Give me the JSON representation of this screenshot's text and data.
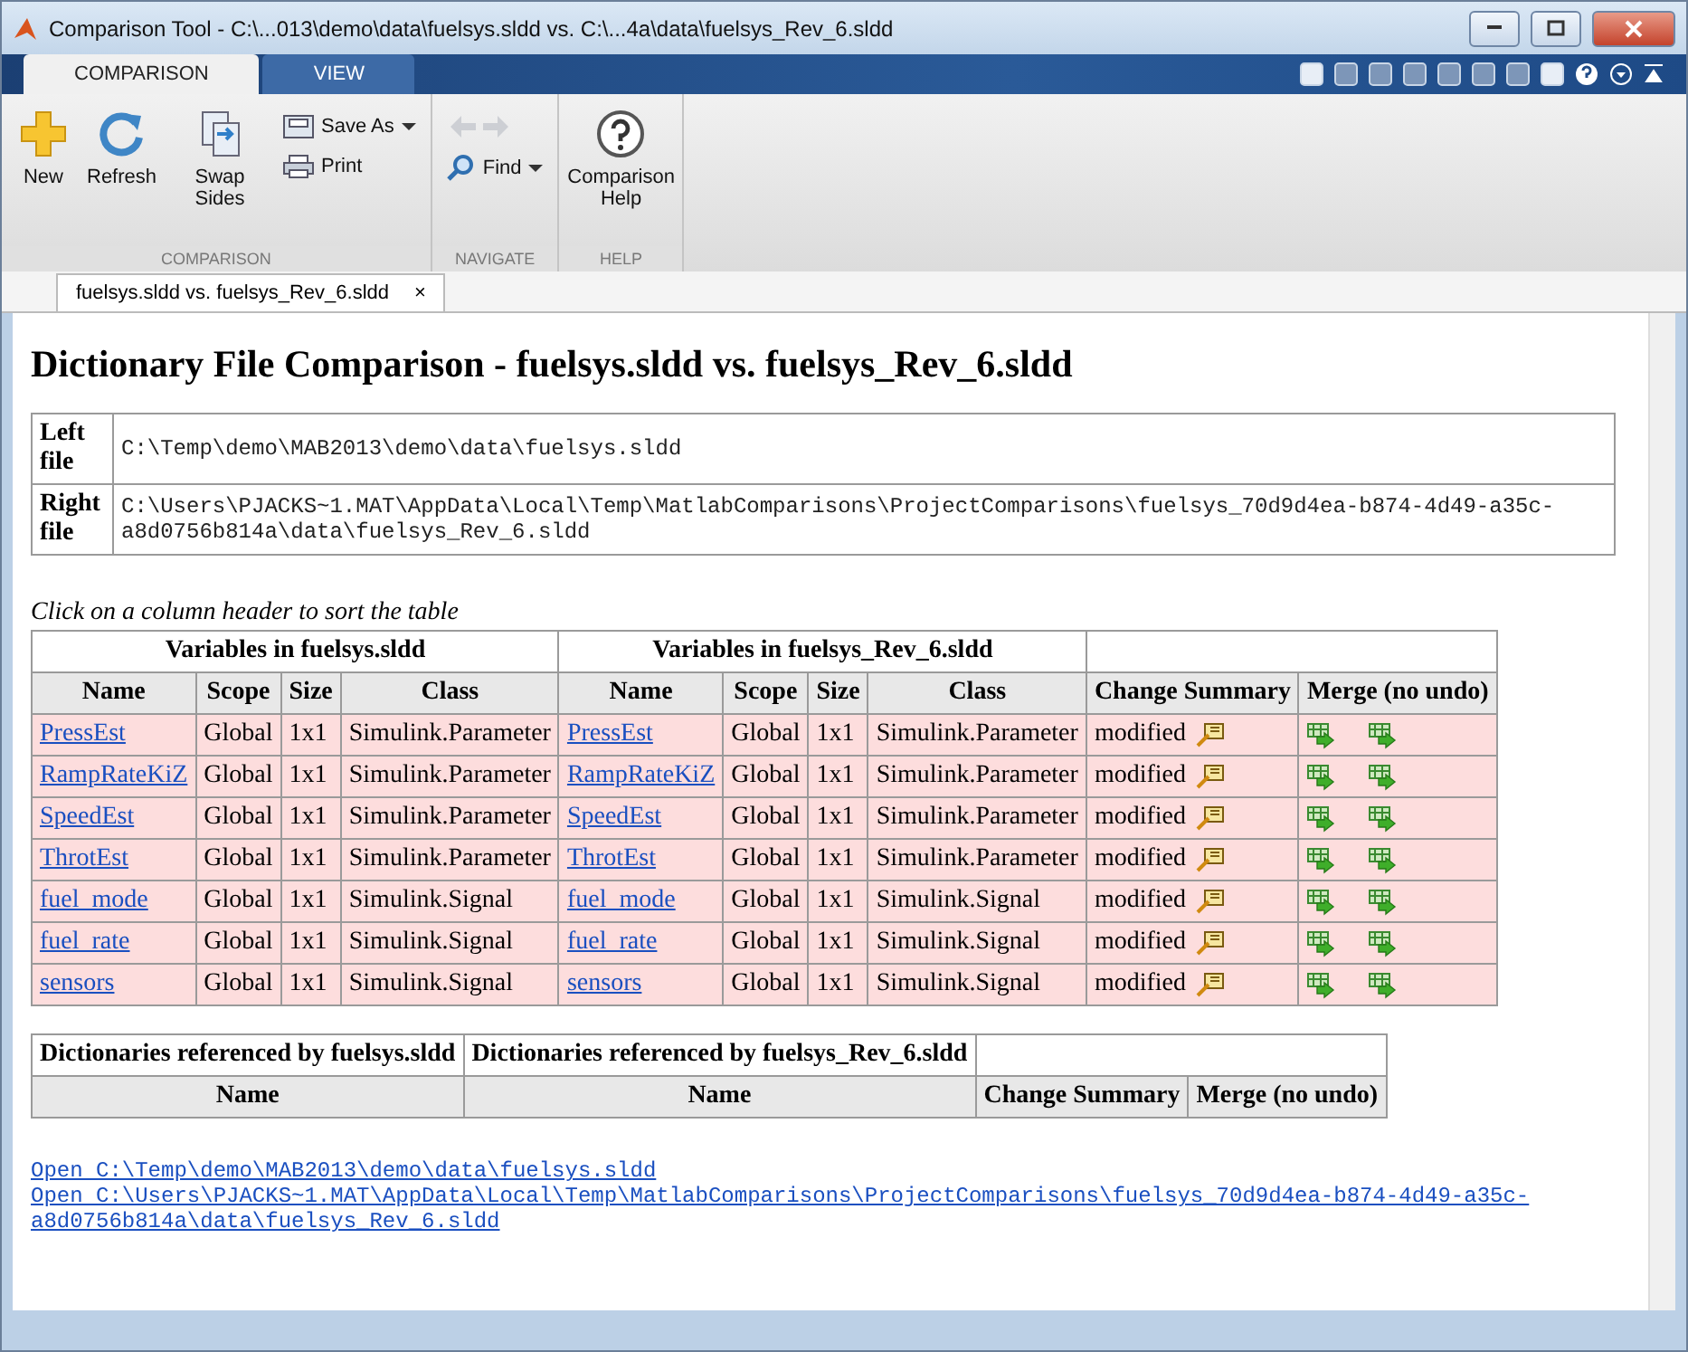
{
  "window": {
    "title": "Comparison Tool - C:\\...013\\demo\\data\\fuelsys.sldd vs. C:\\...4a\\data\\fuelsys_Rev_6.sldd"
  },
  "ribbon": {
    "tabs": [
      {
        "label": "COMPARISON",
        "selected": true
      },
      {
        "label": "VIEW",
        "selected": false
      }
    ],
    "groups": [
      {
        "label": "COMPARISON",
        "buttons": [
          {
            "label": "New",
            "disabled": false
          },
          {
            "label": "Refresh",
            "disabled": false
          },
          {
            "label": "Swap Sides",
            "disabled": false
          }
        ],
        "stack": [
          {
            "label": "Save As",
            "dropdown": true,
            "disabled": false
          },
          {
            "label": "Print",
            "dropdown": false,
            "disabled": false
          }
        ]
      },
      {
        "label": "NAVIGATE",
        "stack": [
          {
            "dropdown": false,
            "disabled": true
          },
          {
            "label": "Find",
            "dropdown": true,
            "disabled": false
          }
        ]
      },
      {
        "label": "HELP",
        "buttons": [
          {
            "label": "Comparison Help",
            "disabled": false
          }
        ]
      }
    ]
  },
  "document_tabs": [
    {
      "label": "fuelsys.sldd vs. fuelsys_Rev_6.sldd",
      "close": "×",
      "selected": true
    }
  ],
  "report": {
    "heading": "Dictionary File Comparison - fuelsys.sldd vs. fuelsys_Rev_6.sldd",
    "files": [
      {
        "label": "Left file",
        "path": "C:\\Temp\\demo\\MAB2013\\demo\\data\\fuelsys.sldd"
      },
      {
        "label": "Right file",
        "path": "C:\\Users\\PJACKS~1.MAT\\AppData\\Local\\Temp\\MatlabComparisons\\ProjectComparisons\\fuelsys_70d9d4ea-b874-4d49-a35c-a8d0756b814a\\data\\fuelsys_Rev_6.sldd"
      }
    ],
    "caption": "Click on a column header to sort the table",
    "variables": {
      "groups": [
        "Variables in fuelsys.sldd",
        "Variables in fuelsys_Rev_6.sldd"
      ],
      "columns": [
        "Name",
        "Scope",
        "Size",
        "Class",
        "Name",
        "Scope",
        "Size",
        "Class",
        "Change Summary",
        "Merge (no undo)"
      ],
      "rows": [
        {
          "changed": true,
          "left": [
            "PressEst",
            "Global",
            "1x1",
            "Simulink.Parameter"
          ],
          "right": [
            "PressEst",
            "Global",
            "1x1",
            "Simulink.Parameter"
          ],
          "change": "modified"
        },
        {
          "changed": true,
          "left": [
            "RampRateKiZ",
            "Global",
            "1x1",
            "Simulink.Parameter"
          ],
          "right": [
            "RampRateKiZ",
            "Global",
            "1x1",
            "Simulink.Parameter"
          ],
          "change": "modified"
        },
        {
          "changed": true,
          "left": [
            "SpeedEst",
            "Global",
            "1x1",
            "Simulink.Parameter"
          ],
          "right": [
            "SpeedEst",
            "Global",
            "1x1",
            "Simulink.Parameter"
          ],
          "change": "modified"
        },
        {
          "changed": true,
          "left": [
            "ThrotEst",
            "Global",
            "1x1",
            "Simulink.Parameter"
          ],
          "right": [
            "ThrotEst",
            "Global",
            "1x1",
            "Simulink.Parameter"
          ],
          "change": "modified"
        },
        {
          "changed": true,
          "left": [
            "fuel_mode",
            "Global",
            "1x1",
            "Simulink.Signal"
          ],
          "right": [
            "fuel_mode",
            "Global",
            "1x1",
            "Simulink.Signal"
          ],
          "change": "modified"
        },
        {
          "changed": true,
          "left": [
            "fuel_rate",
            "Global",
            "1x1",
            "Simulink.Signal"
          ],
          "right": [
            "fuel_rate",
            "Global",
            "1x1",
            "Simulink.Signal"
          ],
          "change": "modified"
        },
        {
          "changed": true,
          "left": [
            "sensors",
            "Global",
            "1x1",
            "Simulink.Signal"
          ],
          "right": [
            "sensors",
            "Global",
            "1x1",
            "Simulink.Signal"
          ],
          "change": "modified"
        }
      ]
    },
    "dictionaries": {
      "groups": [
        "Dictionaries referenced by fuelsys.sldd",
        "Dictionaries referenced by fuelsys_Rev_6.sldd"
      ],
      "columns": [
        "Name",
        "Name",
        "Change Summary",
        "Merge (no undo)"
      ]
    },
    "links": [
      "Open C:\\Temp\\demo\\MAB2013\\demo\\data\\fuelsys.sldd",
      "Open C:\\Users\\PJACKS~1.MAT\\AppData\\Local\\Temp\\MatlabComparisons\\ProjectComparisons\\fuelsys_70d9d4ea-b874-4d49-a35c-a8d0756b814a\\data\\fuelsys_Rev_6.sldd"
    ]
  }
}
